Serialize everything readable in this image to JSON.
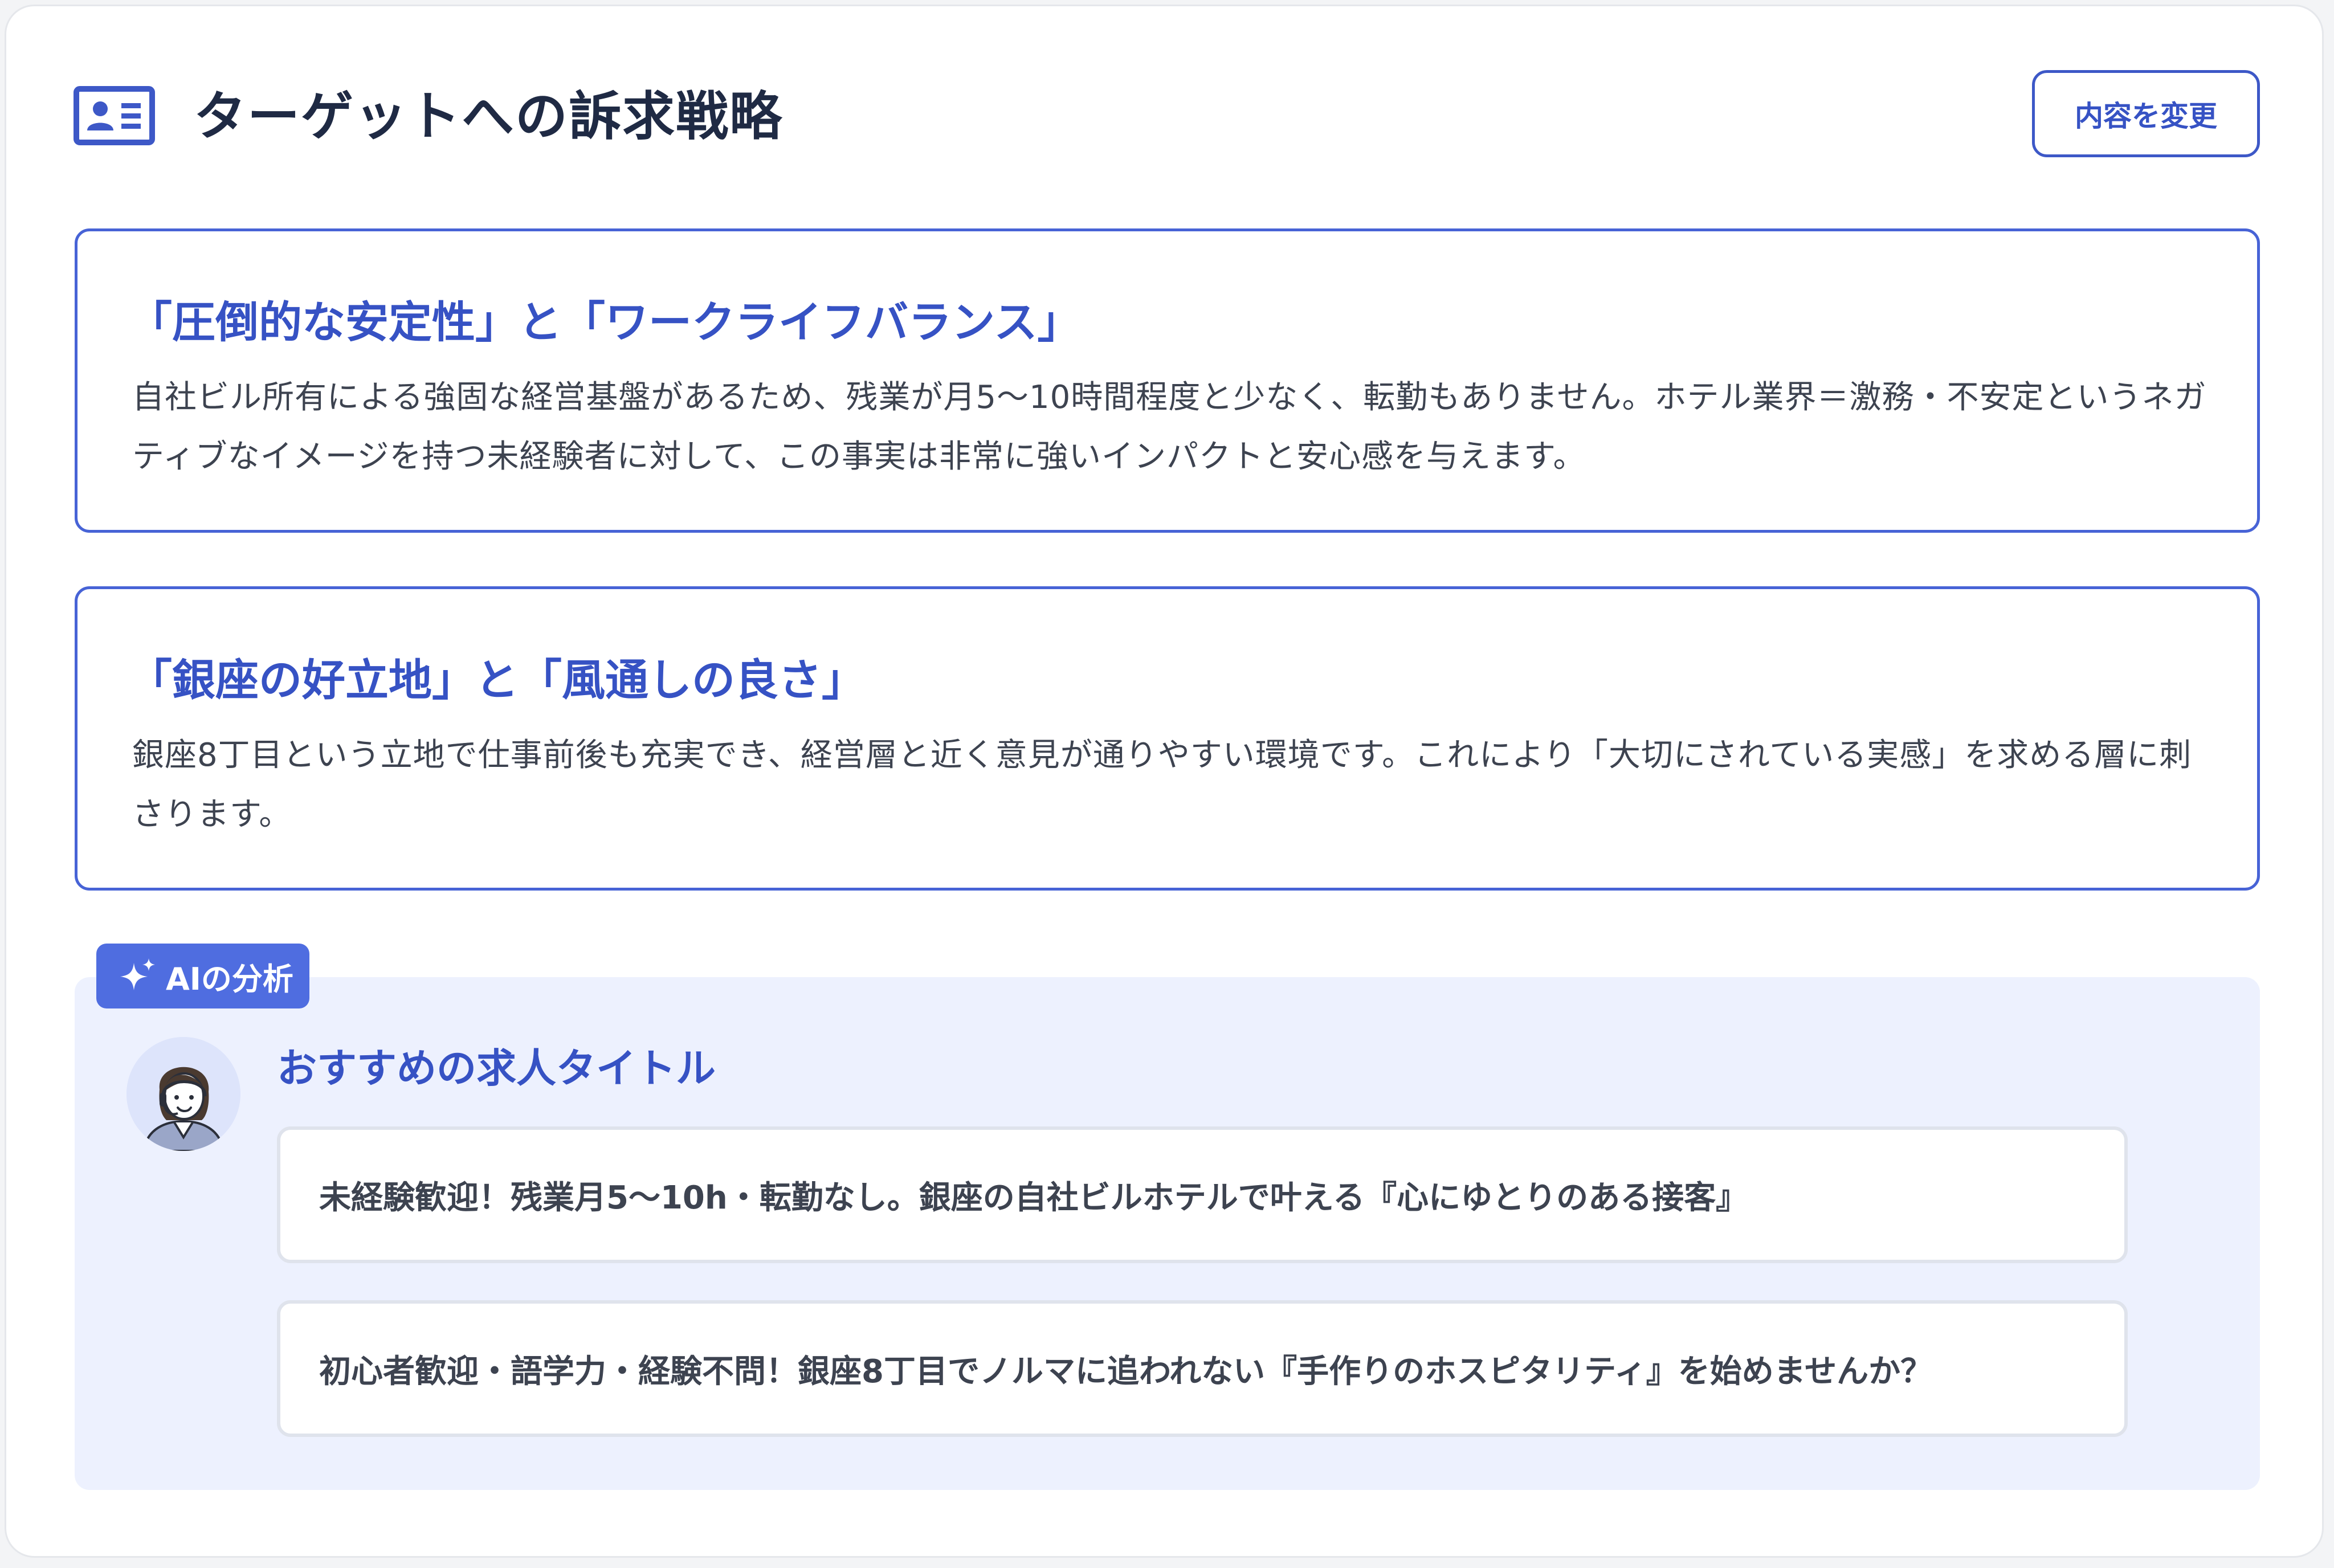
{
  "header": {
    "title": "ターゲットへの訴求戦略",
    "icon": "id-card-icon",
    "edit_button_label": "内容を変更"
  },
  "strategies": [
    {
      "heading": "「圧倒的な安定性」と「ワークライフバランス」",
      "body": "自社ビル所有による強固な経営基盤があるため、残業が月5〜10時間程度と少なく、転勤もありません。ホテル業界＝激務・不安定というネガティブなイメージを持つ未経験者に対して、この事実は非常に強いインパクトと安心感を与えます。"
    },
    {
      "heading": "「銀座の好立地」と「風通しの良さ」",
      "body": "銀座8丁目という立地で仕事前後も充実でき、経営層と近く意見が通りやすい環境です。これにより「大切にされている実感」を求める層に刺さります。"
    }
  ],
  "ai_analysis": {
    "badge_label": "AIの分析",
    "badge_icon": "sparkle-icon",
    "avatar_icon": "assistant-avatar",
    "section_title": "おすすめの求人タイトル",
    "job_titles": [
      "未経験歓迎！残業月5〜10h・転勤なし。銀座の自社ビルホテルで叶える『心にゆとりのある接客』",
      "初心者歓迎・語学力・経験不問！銀座8丁目でノルマに追われない『手作りのホスピタリティ』を始めませんか？"
    ]
  },
  "colors": {
    "accent": "#3652c4",
    "badge_bg": "#4f6de0",
    "panel_bg": "#edf1fe",
    "text": "#3d4350",
    "title": "#1f2a44"
  }
}
